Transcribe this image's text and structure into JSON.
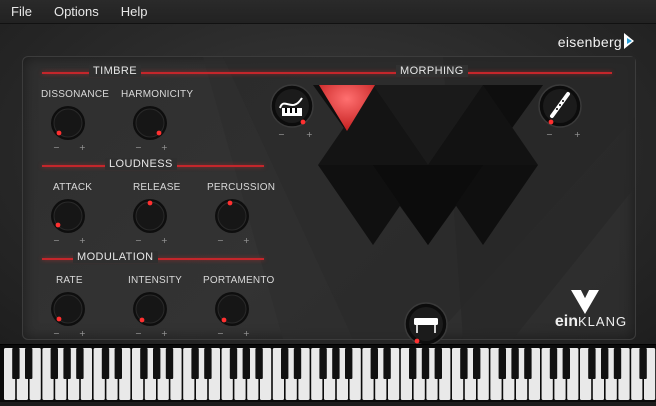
{
  "menu": {
    "items": [
      "File",
      "Options",
      "Help"
    ]
  },
  "brand": {
    "name": "eisenberg"
  },
  "product": {
    "prefix": "ein",
    "suffix": "KLANG"
  },
  "sections": {
    "timbre": "TIMBRE",
    "morphing": "MORPHING",
    "loudness": "LOUDNESS",
    "modulation": "MODULATION"
  },
  "knobs": {
    "dissonance": "DISSONANCE",
    "harmonicity": "HARMONICITY",
    "attack": "ATTACK",
    "release": "RELEASE",
    "percussion": "PERCUSSION",
    "rate": "RATE",
    "intensity": "INTENSITY",
    "portamento": "PORTAMENTO"
  },
  "signs": {
    "minus": "−",
    "plus": "+"
  },
  "colors": {
    "accent": "#c4262b",
    "background": "#1b1b1b",
    "panel": "#2f2f2f",
    "text": "#e6e6e6"
  },
  "icons": {
    "brand": "eisenberg-logo-icon",
    "product": "einklang-logo-icon",
    "morph_left": "synth-keyboard-icon",
    "morph_right": "flute-icon",
    "morph_bottom": "electric-piano-icon"
  }
}
